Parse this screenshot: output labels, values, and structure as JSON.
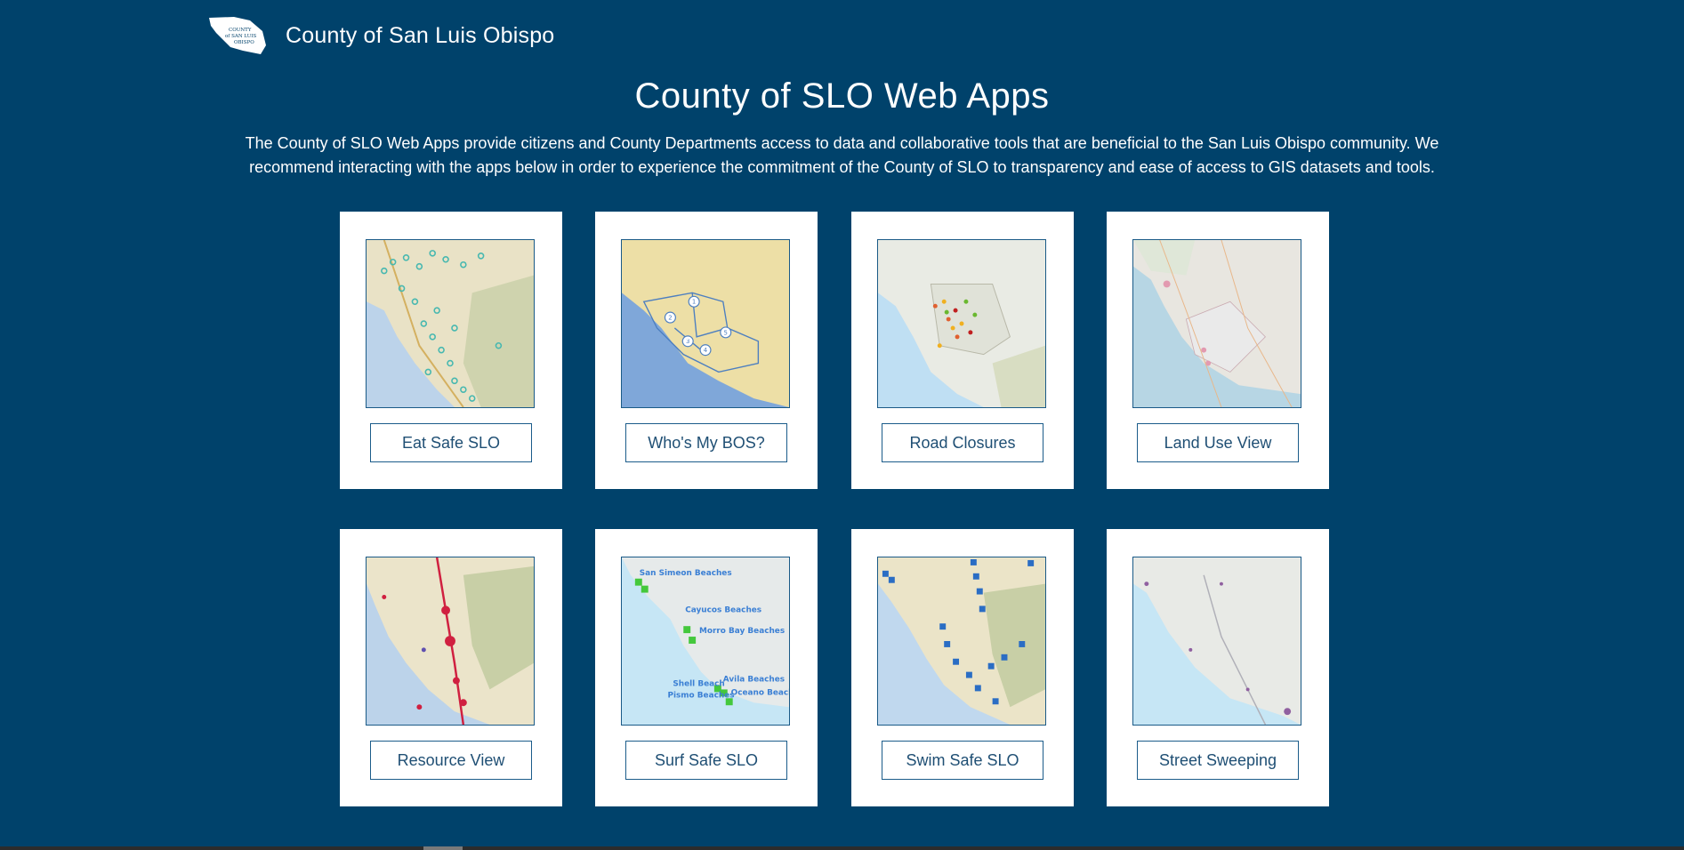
{
  "header": {
    "site_title": "County of San Luis Obispo",
    "logo_text": "COUNTY of SAN LUIS OBISPO"
  },
  "main": {
    "title": "County of SLO Web Apps",
    "intro_line1": "The County of SLO Web Apps provide citizens and County Departments access to data and collaborative tools that are beneficial to the San Luis Obispo community. We",
    "intro_line2": "recommend interacting with the apps below in order to experience the commitment of the County of SLO to transparency and ease of access to GIS datasets and tools."
  },
  "apps": [
    {
      "label": "Eat Safe SLO",
      "thumb": "food-facilities-map"
    },
    {
      "label": "Who's My BOS?",
      "thumb": "supervisorial-districts-map",
      "district_numbers": [
        "1",
        "2",
        "3",
        "4",
        "5"
      ]
    },
    {
      "label": "Road Closures",
      "thumb": "road-closures-map"
    },
    {
      "label": "Land Use View",
      "thumb": "land-use-map"
    },
    {
      "label": "Resource View",
      "thumb": "resource-map"
    },
    {
      "label": "Surf Safe SLO",
      "thumb": "beaches-map",
      "map_labels": [
        "San Simeon Beaches",
        "Cayucos Beaches",
        "Morro Bay Beaches",
        "Shell Beach",
        "Avila Beaches",
        "Pismo Beaches",
        "Oceano Beaches"
      ]
    },
    {
      "label": "Swim Safe SLO",
      "thumb": "swim-sites-map"
    },
    {
      "label": "Street Sweeping",
      "thumb": "street-sweeping-map"
    }
  ],
  "colors": {
    "background": "#00426b",
    "card": "#ffffff",
    "button_text": "#1f4f74",
    "button_border": "#1b5c8a"
  }
}
